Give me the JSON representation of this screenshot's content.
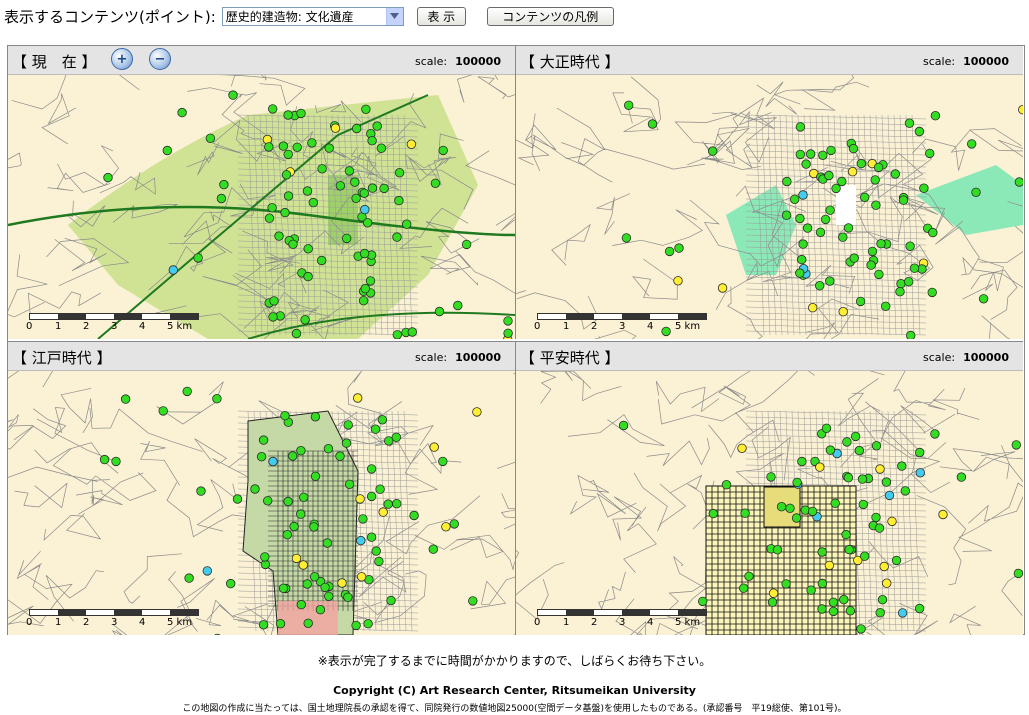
{
  "toolbar": {
    "label": "表示するコンテンツ(ポイント):",
    "select_value": "歴史的建造物: 文化遺産",
    "show_button": "表 示",
    "legend_button": "コンテンツの凡例"
  },
  "panels": [
    {
      "title": "【 現　在 】",
      "scale_label": "scale:",
      "scale_value": "100000"
    },
    {
      "title": "【 大正時代 】",
      "scale_label": "scale:",
      "scale_value": "100000"
    },
    {
      "title": "【 江戸時代 】",
      "scale_label": "scale:",
      "scale_value": "100000"
    },
    {
      "title": "【 平安時代 】",
      "scale_label": "scale:",
      "scale_value": "100000"
    }
  ],
  "zoom": {
    "in": "+",
    "out": "−"
  },
  "scalebar_ticks": [
    "0",
    "1",
    "2",
    "3",
    "4",
    "5 km"
  ],
  "colors": {
    "map_background": "#fbf1d4",
    "point_green": "#33dd22",
    "point_yellow": "#ffee33",
    "point_cyan": "#44ccee",
    "present_landuse": "#c8e08a",
    "taisho_landuse": "#6fe7b0",
    "edo_landuse": "#c5d9a7",
    "heian_grid": "#fbf5b9"
  },
  "footer": {
    "note": "※表示が完了するまでに時間がかかりますので、しばらくお待ち下さい。",
    "copyright": "Copyright (C) Art Research Center, Ritsumeikan University",
    "survey": "この地図の作成に当たっては、国土地理院長の承認を得て、同院発行の数値地図25000(空間データ基盤)を使用したものである。(承認番号　平19総使、第101号)。"
  }
}
